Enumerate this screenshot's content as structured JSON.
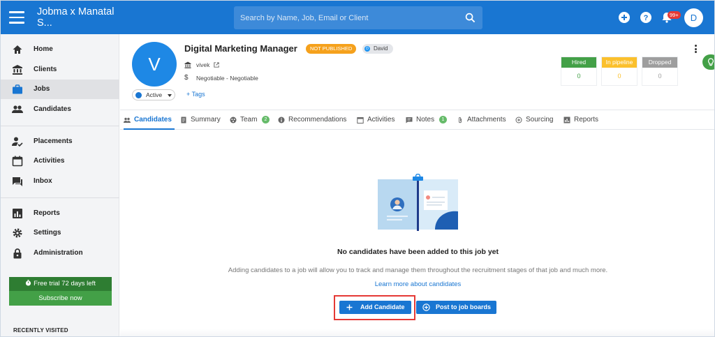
{
  "app": {
    "name": "Jobma x Manatal S..."
  },
  "search": {
    "placeholder": "Search by Name, Job, Email or Client"
  },
  "topbar": {
    "notification_count": "99+",
    "user_initial": "D"
  },
  "sidebar": {
    "items": [
      {
        "label": "Home",
        "icon": "home-icon"
      },
      {
        "label": "Clients",
        "icon": "bank-icon"
      },
      {
        "label": "Jobs",
        "icon": "briefcase-icon",
        "active": true
      },
      {
        "label": "Candidates",
        "icon": "people-icon"
      },
      {
        "label": "Placements",
        "icon": "person-check-icon"
      },
      {
        "label": "Activities",
        "icon": "calendar-icon"
      },
      {
        "label": "Inbox",
        "icon": "chat-icon"
      },
      {
        "label": "Reports",
        "icon": "bar-chart-icon"
      },
      {
        "label": "Settings",
        "icon": "gear-icon"
      },
      {
        "label": "Administration",
        "icon": "lock-icon"
      }
    ],
    "trial_text": "Free trial 72 days left",
    "subscribe_label": "Subscribe now",
    "recently_visited": "RECENTLY VISITED"
  },
  "job": {
    "avatar_letter": "V",
    "status": "Active",
    "title": "Digital Marketing Manager",
    "publish_badge": "NOT PUBLISHED",
    "owner_initial": "D",
    "owner": "David",
    "client": "vivek",
    "salary": "Negotiable - Negotiable",
    "tags_label": "+ Tags"
  },
  "stats": [
    {
      "label": "Hired",
      "value": "0",
      "color": "#43a047"
    },
    {
      "label": "In pipeline",
      "value": "0",
      "color": "#fbc02d"
    },
    {
      "label": "Dropped",
      "value": "0",
      "color": "#9e9e9e"
    }
  ],
  "tabs": [
    {
      "label": "Candidates",
      "active": true
    },
    {
      "label": "Summary"
    },
    {
      "label": "Team",
      "count": "2"
    },
    {
      "label": "Recommendations"
    },
    {
      "label": "Activities"
    },
    {
      "label": "Notes",
      "count": "1"
    },
    {
      "label": "Attachments"
    },
    {
      "label": "Sourcing"
    },
    {
      "label": "Reports"
    }
  ],
  "empty": {
    "title": "No candidates have been added to this job yet",
    "description": "Adding candidates to a job will allow you to track and manage them throughout the recruitment stages of that job and much more.",
    "learn_more": "Learn more about candidates",
    "add_label": "Add Candidate",
    "post_label": "Post to job boards"
  },
  "colors": {
    "primary": "#1976d2",
    "highlight": "#e53935"
  }
}
